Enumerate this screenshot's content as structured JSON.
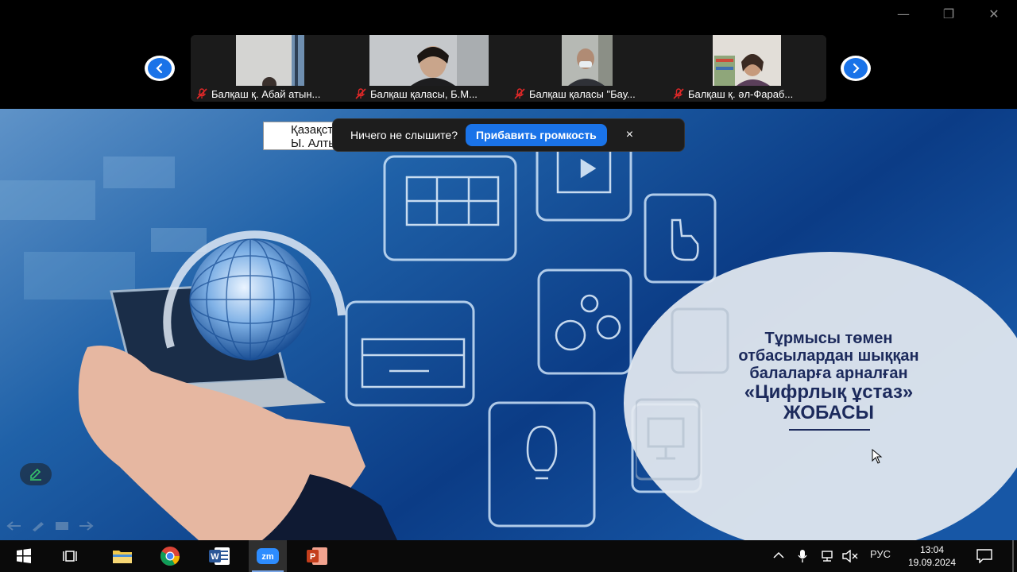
{
  "window": {
    "minimize_glyph": "—",
    "restore_glyph": "❐",
    "close_glyph": "✕"
  },
  "participants": [
    {
      "name": "Балқаш қ. Абай атын...",
      "video_bg": "#c9c9c9"
    },
    {
      "name": "Балқаш қаласы, Б.М...",
      "video_bg": "#bfc3c8"
    },
    {
      "name": "Балқаш қаласы \"Бау...",
      "video_bg": "#b8bcb8"
    },
    {
      "name": "Балқаш қ. әл-Фараб...",
      "video_bg": "#d8d4cf"
    }
  ],
  "nav": {
    "prev_icon": "chevron-left-icon",
    "next_icon": "chevron-right-icon"
  },
  "share": {
    "header_line1": "Қазақстан Республикасының",
    "header_line2": "Ы. Алтынсарин атындағы",
    "notification": {
      "question": "Ничего не слышите?",
      "button": "Прибавить громкость",
      "close": "×"
    },
    "slide_title": {
      "line1": "Тұрмысы төмен",
      "line2": "отбасылардан шыққан",
      "line3": "балаларға арналған",
      "line4": "«Цифрлық ұстаз»",
      "line5": "ЖОБАСЫ"
    }
  },
  "taskbar": {
    "apps": [
      "windows-start",
      "task-view",
      "file-explorer",
      "chrome",
      "word",
      "zoom",
      "powerpoint"
    ],
    "tray": {
      "language": "РУС",
      "time": "13:04",
      "date": "19.09.2024"
    }
  },
  "colors": {
    "accent": "#1a73e8",
    "slide_title": "#1c2a5c",
    "mic_off": "#e02828"
  }
}
